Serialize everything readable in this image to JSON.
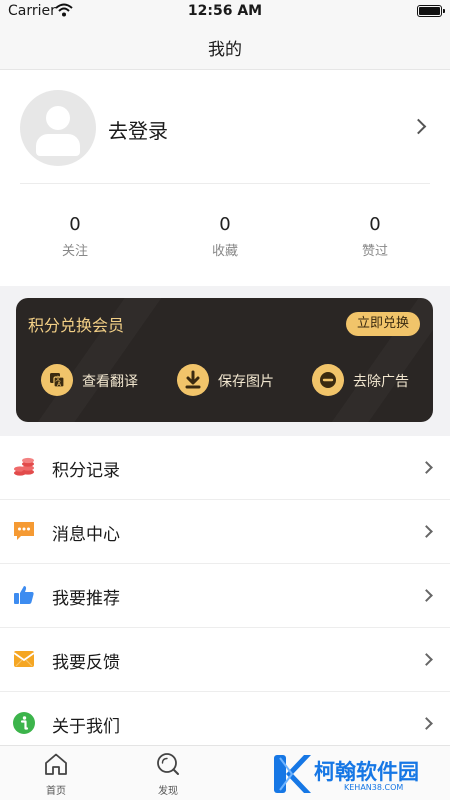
{
  "status_bar": {
    "carrier": "Carrier",
    "time": "12:56 AM"
  },
  "nav": {
    "title": "我的"
  },
  "profile": {
    "login_label": "去登录",
    "stats": [
      {
        "value": "0",
        "label": "关注"
      },
      {
        "value": "0",
        "label": "收藏"
      },
      {
        "value": "0",
        "label": "赞过"
      }
    ]
  },
  "vip": {
    "title": "积分兑换会员",
    "button": "立即兑换",
    "features": [
      {
        "label": "查看翻译",
        "icon": "translate-icon"
      },
      {
        "label": "保存图片",
        "icon": "download-icon"
      },
      {
        "label": "去除广告",
        "icon": "remove-ad-icon"
      }
    ]
  },
  "menu": [
    {
      "label": "积分记录",
      "icon": "coins-icon"
    },
    {
      "label": "消息中心",
      "icon": "message-icon"
    },
    {
      "label": "我要推荐",
      "icon": "thumbs-up-icon"
    },
    {
      "label": "我要反馈",
      "icon": "mail-icon"
    },
    {
      "label": "关于我们",
      "icon": "info-icon"
    }
  ],
  "tabs": [
    {
      "label": "首页",
      "icon": "home-icon"
    },
    {
      "label": "发现",
      "icon": "discover-icon"
    }
  ],
  "watermark": {
    "text": "柯翰软件园",
    "sub": "KEHAN38.COM"
  },
  "colors": {
    "gold": "#f1c46a",
    "card_dark": "#2a2624",
    "blue": "#1677e5"
  }
}
